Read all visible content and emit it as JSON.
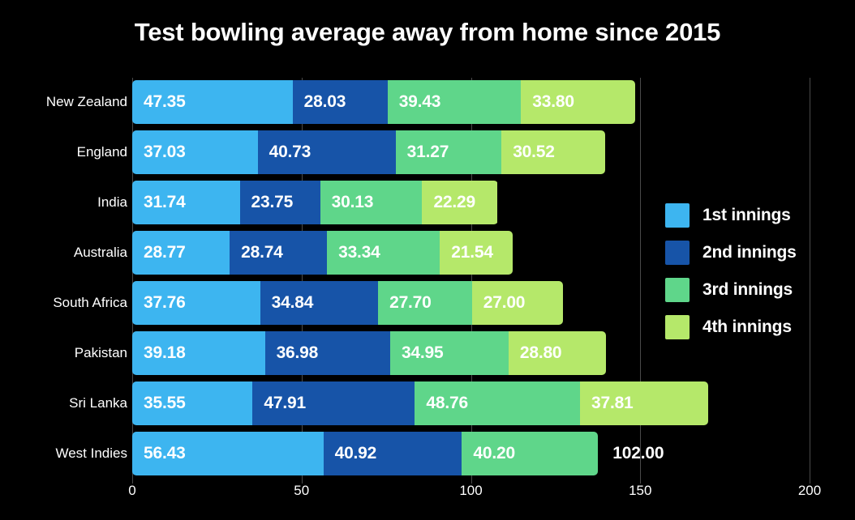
{
  "chart_data": {
    "type": "bar",
    "orientation": "horizontal",
    "stacked": true,
    "title": "Test bowling average away from home since 2015",
    "xlabel": "",
    "ylabel": "",
    "xlim": [
      0,
      200
    ],
    "xticks": [
      0,
      50,
      100,
      150,
      200
    ],
    "xtick_labels": [
      "0",
      "50",
      "100",
      "150",
      "200"
    ],
    "grid": true,
    "grid_axis": "x",
    "legend_position": "right",
    "background_color": "#000000",
    "text_color": "#ffffff",
    "categories": [
      "New Zealand",
      "England",
      "India",
      "Australia",
      "South Africa",
      "Pakistan",
      "Sri Lanka",
      "West Indies"
    ],
    "series": [
      {
        "name": "1st innings",
        "color": "#3db5f0",
        "values": [
          47.35,
          37.03,
          31.74,
          28.77,
          37.76,
          39.18,
          35.55,
          56.43
        ],
        "labels": [
          "47.35",
          "37.03",
          "31.74",
          "28.77",
          "37.76",
          "39.18",
          "35.55",
          "56.43"
        ]
      },
      {
        "name": "2nd innings",
        "color": "#1754a8",
        "values": [
          28.03,
          40.73,
          23.75,
          28.74,
          34.84,
          36.98,
          47.91,
          40.92
        ],
        "labels": [
          "28.03",
          "40.73",
          "23.75",
          "28.74",
          "34.84",
          "36.98",
          "47.91",
          "40.92"
        ]
      },
      {
        "name": "3rd innings",
        "color": "#5fd68a",
        "values": [
          39.43,
          31.27,
          30.13,
          33.34,
          27.7,
          34.95,
          48.76,
          40.2
        ],
        "labels": [
          "39.43",
          "31.27",
          "30.13",
          "33.34",
          "27.70",
          "34.95",
          "48.76",
          "40.20"
        ]
      },
      {
        "name": "4th innings",
        "color": "#b5e86a",
        "values": [
          33.8,
          30.52,
          22.29,
          21.54,
          27.0,
          28.8,
          37.81,
          102.0
        ],
        "labels": [
          "33.80",
          "30.52",
          "22.29",
          "21.54",
          "27.00",
          "28.80",
          "37.81",
          "102.00"
        ],
        "clipped_index": 7
      }
    ],
    "totals": [
      148.61,
      139.55,
      107.91,
      112.39,
      127.3,
      139.91,
      170.03,
      137.55
    ]
  },
  "legend": {
    "items": [
      {
        "label": "1st innings",
        "color": "#3db5f0"
      },
      {
        "label": "2nd innings",
        "color": "#1754a8"
      },
      {
        "label": "3rd innings",
        "color": "#5fd68a"
      },
      {
        "label": "4th innings",
        "color": "#b5e86a"
      }
    ]
  }
}
